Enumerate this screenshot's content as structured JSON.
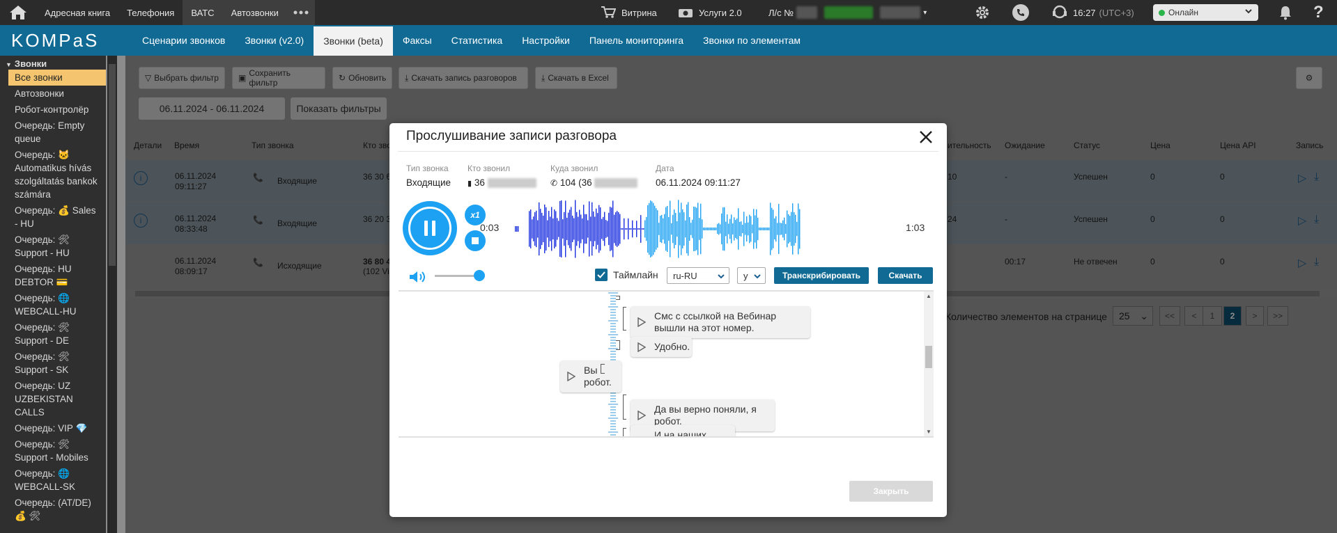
{
  "topbar": {
    "nav": [
      "Адресная книга",
      "Телефония",
      "ВАТС",
      "Автозвонки"
    ],
    "vitrina": "Витрина",
    "services": "Услуги 2.0",
    "account_label": "Л/с №",
    "time": "16:27",
    "timezone": "(UTC+3)",
    "status": "Онлайн"
  },
  "header": {
    "logo": "KOMPaS",
    "tabs": [
      "Сценарии звонков",
      "Звонки (v2.0)",
      "Звонки (beta)",
      "Факсы",
      "Статистика",
      "Настройки",
      "Панель мониторинга",
      "Звонки по элементам"
    ],
    "active_tab": "Звонки (beta)"
  },
  "sidebar": {
    "title": "Звонки",
    "items": [
      "Все звонки",
      "Автозвонки",
      "Робот-контролёр",
      "Очередь: Empty queue",
      "Очередь: 🐱 Automatikus hívás szolgáltatás bankok számára",
      "Очередь: 💰 Sales - HU",
      "Очередь: 🛠 Support - HU",
      "Очередь: HU DEBTOR 💳",
      "Очередь: 🌐 WEBCALL-HU",
      "Очередь: 🛠 Support - DE",
      "Очередь: 🛠 Support - SK",
      "Очередь: UZ UZBEKISTAN CALLS",
      "Очередь: VIP 💎",
      "Очередь: 🛠 Support - Mobiles",
      "Очередь: 🌐 WEBCALL-SK",
      "Очередь: (AT/DE) 💰 🛠"
    ]
  },
  "toolbar": {
    "filter": "Выбрать фильтр",
    "save_filter": "Сохранить фильтр",
    "refresh": "Обновить",
    "download_records": "Скачать запись разговоров",
    "download_excel": "Скачать в Excel",
    "date_range": "06.11.2024 - 06.11.2024",
    "show_filters": "Показать фильтры"
  },
  "table": {
    "columns": [
      "Детали",
      "Время",
      "Тип звонка",
      "Кто зво",
      "ительность",
      "Ожидание",
      "Статус",
      "Цена",
      "Цена API",
      "Запись"
    ],
    "rows": [
      {
        "date": "06.11.2024",
        "time": "09:11:27",
        "type": "Входящие",
        "who": "36 30 6",
        "duration": "10",
        "wait": "-",
        "status": "Успешен",
        "price": "0",
        "price_api": "0"
      },
      {
        "date": "06.11.2024",
        "time": "08:33:48",
        "type": "Входящие",
        "who": "36 20 3",
        "duration": "24",
        "wait": "-",
        "status": "Успешен",
        "price": "0",
        "price_api": "0"
      },
      {
        "date": "06.11.2024",
        "time": "08:09:17",
        "type": "Исходящие",
        "who": "36 80 4",
        "who2": "(102 Vi",
        "duration": "",
        "wait": "00:17",
        "status": "Не отвечен",
        "price": "0",
        "price_api": "0"
      }
    ]
  },
  "pagination": {
    "label": "Количество элементов на странице",
    "per_page": "25",
    "pages": [
      "<<",
      "<",
      "1",
      "2",
      ">",
      ">>"
    ],
    "active_page": "2"
  },
  "modal": {
    "title": "Прослушивание записи разговора",
    "labels": {
      "type": "Тип звонка",
      "from": "Кто звонил",
      "to": "Куда звонил",
      "date": "Дата"
    },
    "values": {
      "type": "Входящие",
      "from": "36",
      "to": "104 (36",
      "date": "06.11.2024 09:11:27"
    },
    "speed": "x1",
    "time_current": "0:03",
    "time_total": "1:03",
    "timeline_label": "Таймлайн",
    "timeline_checked": true,
    "language": "ru-RU",
    "mode": "y",
    "transcribe_button": "Транскрибировать",
    "download_button": "Скачать",
    "close_button": "Закрыть",
    "transcript": [
      {
        "side": "right",
        "text": "Смс с ссылкой на Вебинар вышли на этот номер."
      },
      {
        "side": "right",
        "text": "Удобно."
      },
      {
        "side": "left",
        "text": "Вы робот."
      },
      {
        "side": "right",
        "text": "Да вы верно поняли, я робот."
      },
      {
        "side": "right",
        "text": "И на наших курсах"
      }
    ]
  },
  "colors": {
    "accent": "#1da1f2",
    "brand": "#106a94",
    "active_sidebar": "#f4c56e"
  }
}
